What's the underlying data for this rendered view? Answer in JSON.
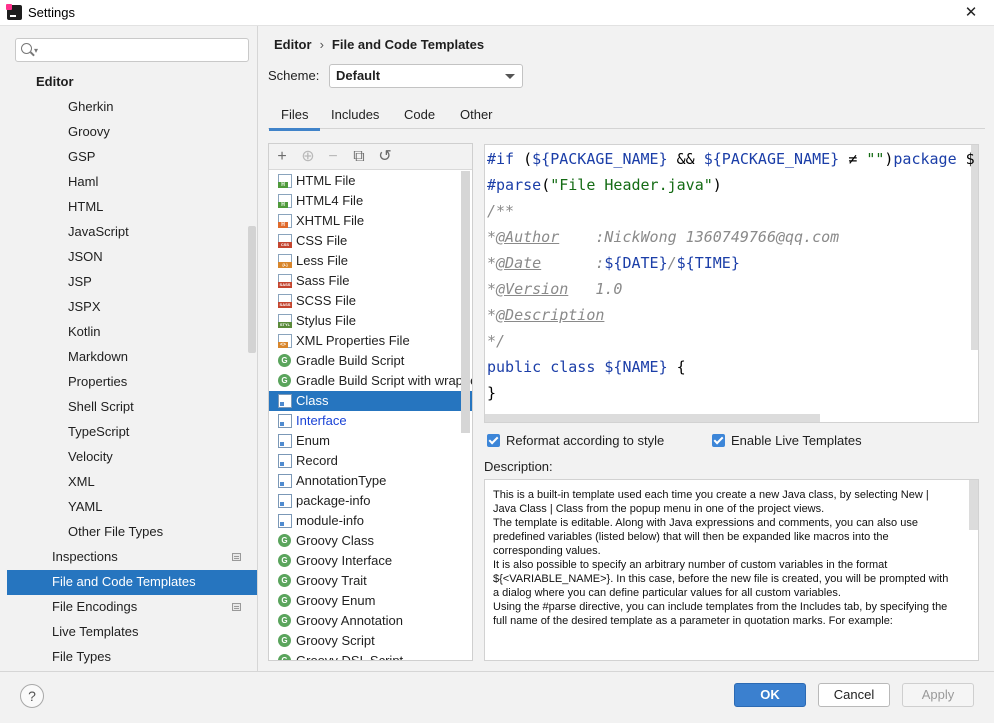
{
  "window": {
    "title": "Settings"
  },
  "sidebar": {
    "search_placeholder": "Q-",
    "items": [
      {
        "label": "Editor",
        "level": 1,
        "bold": true
      },
      {
        "label": "Gherkin",
        "level": 2
      },
      {
        "label": "Groovy",
        "level": 2
      },
      {
        "label": "GSP",
        "level": 2
      },
      {
        "label": "Haml",
        "level": 2
      },
      {
        "label": "HTML",
        "level": 2
      },
      {
        "label": "JavaScript",
        "level": 2
      },
      {
        "label": "JSON",
        "level": 2
      },
      {
        "label": "JSP",
        "level": 2
      },
      {
        "label": "JSPX",
        "level": 2
      },
      {
        "label": "Kotlin",
        "level": 2
      },
      {
        "label": "Markdown",
        "level": 2
      },
      {
        "label": "Properties",
        "level": 2
      },
      {
        "label": "Shell Script",
        "level": 2
      },
      {
        "label": "TypeScript",
        "level": 2
      },
      {
        "label": "Velocity",
        "level": 2
      },
      {
        "label": "XML",
        "level": 2
      },
      {
        "label": "YAML",
        "level": 2
      },
      {
        "label": "Other File Types",
        "level": 2
      },
      {
        "label": "Inspections",
        "level": 1,
        "badge": true
      },
      {
        "label": "File and Code Templates",
        "level": 1,
        "selected": true
      },
      {
        "label": "File Encodings",
        "level": 1,
        "badge": true
      },
      {
        "label": "Live Templates",
        "level": 1
      },
      {
        "label": "File Types",
        "level": 1
      }
    ]
  },
  "breadcrumb": {
    "parent": "Editor",
    "separator": "›",
    "current": "File and Code Templates"
  },
  "scheme": {
    "label": "Scheme:",
    "value": "Default"
  },
  "tabs": [
    {
      "label": "Files",
      "active": true
    },
    {
      "label": "Includes"
    },
    {
      "label": "Code"
    },
    {
      "label": "Other"
    }
  ],
  "toolbar": {
    "add": "+",
    "add_child": "⊕",
    "remove": "−",
    "copy": "⧉",
    "reset": "↺"
  },
  "templates": [
    {
      "label": "HTML File",
      "icon": "html",
      "icon_text": "H",
      "icon_color": "#4f9a3c"
    },
    {
      "label": "HTML4 File",
      "icon": "html",
      "icon_text": "H",
      "icon_color": "#4f9a3c"
    },
    {
      "label": "XHTML File",
      "icon": "html",
      "icon_text": "H",
      "icon_color": "#e06a2c"
    },
    {
      "label": "CSS File",
      "icon": "css",
      "icon_text": "CSS",
      "icon_color": "#c4452f"
    },
    {
      "label": "Less File",
      "icon": "less",
      "icon_text": "{L}",
      "icon_color": "#d8862c"
    },
    {
      "label": "Sass File",
      "icon": "sass",
      "icon_text": "SASS",
      "icon_color": "#c4452f"
    },
    {
      "label": "SCSS File",
      "icon": "scss",
      "icon_text": "SASS",
      "icon_color": "#c4452f"
    },
    {
      "label": "Stylus File",
      "icon": "stylus",
      "icon_text": "STYL",
      "icon_color": "#5a8a3a"
    },
    {
      "label": "XML Properties File",
      "icon": "xml",
      "icon_text": "<>",
      "icon_color": "#d8862c"
    },
    {
      "label": "Gradle Build Script",
      "icon": "groovy",
      "icon_text": "G",
      "icon_color": "#5aa45c"
    },
    {
      "label": "Gradle Build Script with wrapper",
      "icon": "groovy",
      "icon_text": "G",
      "icon_color": "#5aa45c"
    },
    {
      "label": "Class",
      "icon": "java",
      "icon_text": "",
      "icon_color": "#4f8bd0",
      "selected": true
    },
    {
      "label": "Interface",
      "icon": "java",
      "icon_text": "",
      "icon_color": "#4f8bd0",
      "blue": true
    },
    {
      "label": "Enum",
      "icon": "java",
      "icon_text": "",
      "icon_color": "#4f8bd0"
    },
    {
      "label": "Record",
      "icon": "java",
      "icon_text": "",
      "icon_color": "#4f8bd0"
    },
    {
      "label": "AnnotationType",
      "icon": "java",
      "icon_text": "",
      "icon_color": "#4f8bd0"
    },
    {
      "label": "package-info",
      "icon": "java",
      "icon_text": "",
      "icon_color": "#4f8bd0"
    },
    {
      "label": "module-info",
      "icon": "java",
      "icon_text": "",
      "icon_color": "#4f8bd0"
    },
    {
      "label": "Groovy Class",
      "icon": "groovy",
      "icon_text": "G",
      "icon_color": "#5aa45c"
    },
    {
      "label": "Groovy Interface",
      "icon": "groovy",
      "icon_text": "G",
      "icon_color": "#5aa45c"
    },
    {
      "label": "Groovy Trait",
      "icon": "groovy",
      "icon_text": "G",
      "icon_color": "#5aa45c"
    },
    {
      "label": "Groovy Enum",
      "icon": "groovy",
      "icon_text": "G",
      "icon_color": "#5aa45c"
    },
    {
      "label": "Groovy Annotation",
      "icon": "groovy",
      "icon_text": "G",
      "icon_color": "#5aa45c"
    },
    {
      "label": "Groovy Script",
      "icon": "groovy",
      "icon_text": "G",
      "icon_color": "#5aa45c"
    },
    {
      "label": "Groovy DSL Script",
      "icon": "groovy",
      "icon_text": "G",
      "icon_color": "#5aa45c"
    }
  ],
  "editor": {
    "lines": [
      [
        [
          "kw",
          "#if"
        ],
        [
          "txt",
          " ("
        ],
        [
          "var",
          "${PACKAGE_NAME}"
        ],
        [
          "txt",
          " && "
        ],
        [
          "var",
          "${PACKAGE_NAME}"
        ],
        [
          "txt",
          " ≠ "
        ],
        [
          "str",
          "\"\""
        ],
        [
          "txt",
          ")"
        ],
        [
          "kw",
          "package"
        ],
        [
          "txt",
          " $"
        ]
      ],
      [
        [
          "kw",
          "#parse"
        ],
        [
          "txt",
          "("
        ],
        [
          "str",
          "\"File Header.java\""
        ],
        [
          "txt",
          ")"
        ]
      ],
      [
        [
          "cmt",
          "/**"
        ]
      ],
      [
        [
          "cmt",
          "*"
        ],
        [
          "tag",
          "@Author"
        ],
        [
          "cmt",
          "    :NickWong 1360749766@qq.com"
        ]
      ],
      [
        [
          "cmt",
          "*"
        ],
        [
          "tag",
          "@Date"
        ],
        [
          "cmt",
          "      :"
        ],
        [
          "var",
          "${DATE}"
        ],
        [
          "cmt",
          "/"
        ],
        [
          "var",
          "${TIME}"
        ]
      ],
      [
        [
          "cmt",
          "*"
        ],
        [
          "tag",
          "@Version"
        ],
        [
          "cmt",
          "   1.0"
        ]
      ],
      [
        [
          "cmt",
          "*"
        ],
        [
          "tag",
          "@Description"
        ]
      ],
      [
        [
          "cmt",
          "*/"
        ]
      ],
      [
        [
          "kw",
          "public class "
        ],
        [
          "var",
          "${NAME}"
        ],
        [
          "txt",
          " {"
        ]
      ],
      [
        [
          "txt",
          "}"
        ]
      ]
    ]
  },
  "options": {
    "reformat_label": "Reformat according to style",
    "reformat_checked": true,
    "live_templates_label": "Enable Live Templates",
    "live_templates_checked": true
  },
  "description": {
    "label": "Description:",
    "p1": "This is a built-in template used each time you create a new Java class, by selecting New | Java Class | Class from the popup menu in one of the project views.",
    "p2": "The template is editable. Along with Java expressions and comments, you can also use predefined variables (listed below) that will then be expanded like macros into the corresponding values.",
    "p3": "It is also possible to specify an arbitrary number of custom variables in the format ${<VARIABLE_NAME>}. In this case, before the new file is created, you will be prompted with a dialog where you can define particular values for all custom variables.",
    "p4": "Using the #parse directive, you can include templates from the Includes tab, by specifying the full name of the desired template as a parameter in quotation marks. For example:"
  },
  "buttons": {
    "help": "?",
    "ok": "OK",
    "cancel": "Cancel",
    "apply": "Apply"
  }
}
